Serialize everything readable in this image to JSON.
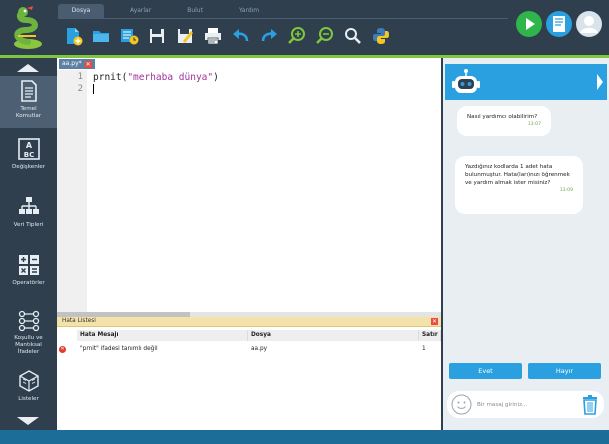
{
  "menu": {
    "tabs": [
      {
        "label": "Dosya",
        "active": true
      },
      {
        "label": "Ayarlar",
        "active": false
      },
      {
        "label": "Bulut",
        "active": false
      },
      {
        "label": "Yardım",
        "active": false
      }
    ]
  },
  "toolbar": {
    "icons": [
      "new-file-icon",
      "open-folder-icon",
      "recent-files-icon",
      "save-icon",
      "save-as-icon",
      "print-icon",
      "undo-icon",
      "redo-icon",
      "zoom-in-icon",
      "zoom-out-icon",
      "search-icon",
      "python-icon"
    ]
  },
  "right_tools": [
    "run-icon",
    "book-icon",
    "user-icon"
  ],
  "sidebar": {
    "items": [
      {
        "label_line1": "Temel",
        "label_line2": "Komutlar",
        "icon": "document-icon",
        "active": true
      },
      {
        "label_line1": "Değişkenler",
        "label_line2": "",
        "icon": "abc-icon",
        "active": false
      },
      {
        "label_line1": "Veri Tipleri",
        "label_line2": "",
        "icon": "hierarchy-icon",
        "active": false
      },
      {
        "label_line1": "Operatörler",
        "label_line2": "",
        "icon": "operators-icon",
        "active": false
      },
      {
        "label_line1": "Koşullu ve",
        "label_line2": "Mantıksal",
        "label_line3": "İfadeler",
        "icon": "logic-icon",
        "active": false
      },
      {
        "label_line1": "Listeler",
        "label_line2": "",
        "icon": "cube-icon",
        "active": false
      }
    ]
  },
  "editor": {
    "file_tab": "aa.py*",
    "lines": [
      {
        "num": "1",
        "code_pre": "prnit(",
        "code_str": "\"merhaba dünya\"",
        "code_post": ")"
      },
      {
        "num": "2",
        "code_pre": "",
        "code_str": "",
        "code_post": ""
      }
    ]
  },
  "errors": {
    "title": "Hata Listesi",
    "columns": [
      "Hata Mesajı",
      "Dosya",
      "Satır"
    ],
    "rows": [
      {
        "message": "\"prnit\" ifadesi tanımlı değil",
        "file": "aa.py",
        "line": "1"
      }
    ]
  },
  "chat": {
    "messages": [
      {
        "text": "Nasıl yardımcı olabilirim?",
        "time": "13:07"
      },
      {
        "text": "Yazdığınız kodlarda 1 adet hata bulunmuştur. Hata(ları)nızı öğrenmek ve yardım almak ister misiniz?",
        "time": "13:09"
      }
    ],
    "yes_label": "Evet",
    "no_label": "Hayır",
    "input_placeholder": "Bir masaj giriniz..."
  },
  "colors": {
    "accent_blue": "#2aa0e0",
    "accent_green": "#7fc63f",
    "sidebar_bg": "#2f3f4e"
  }
}
